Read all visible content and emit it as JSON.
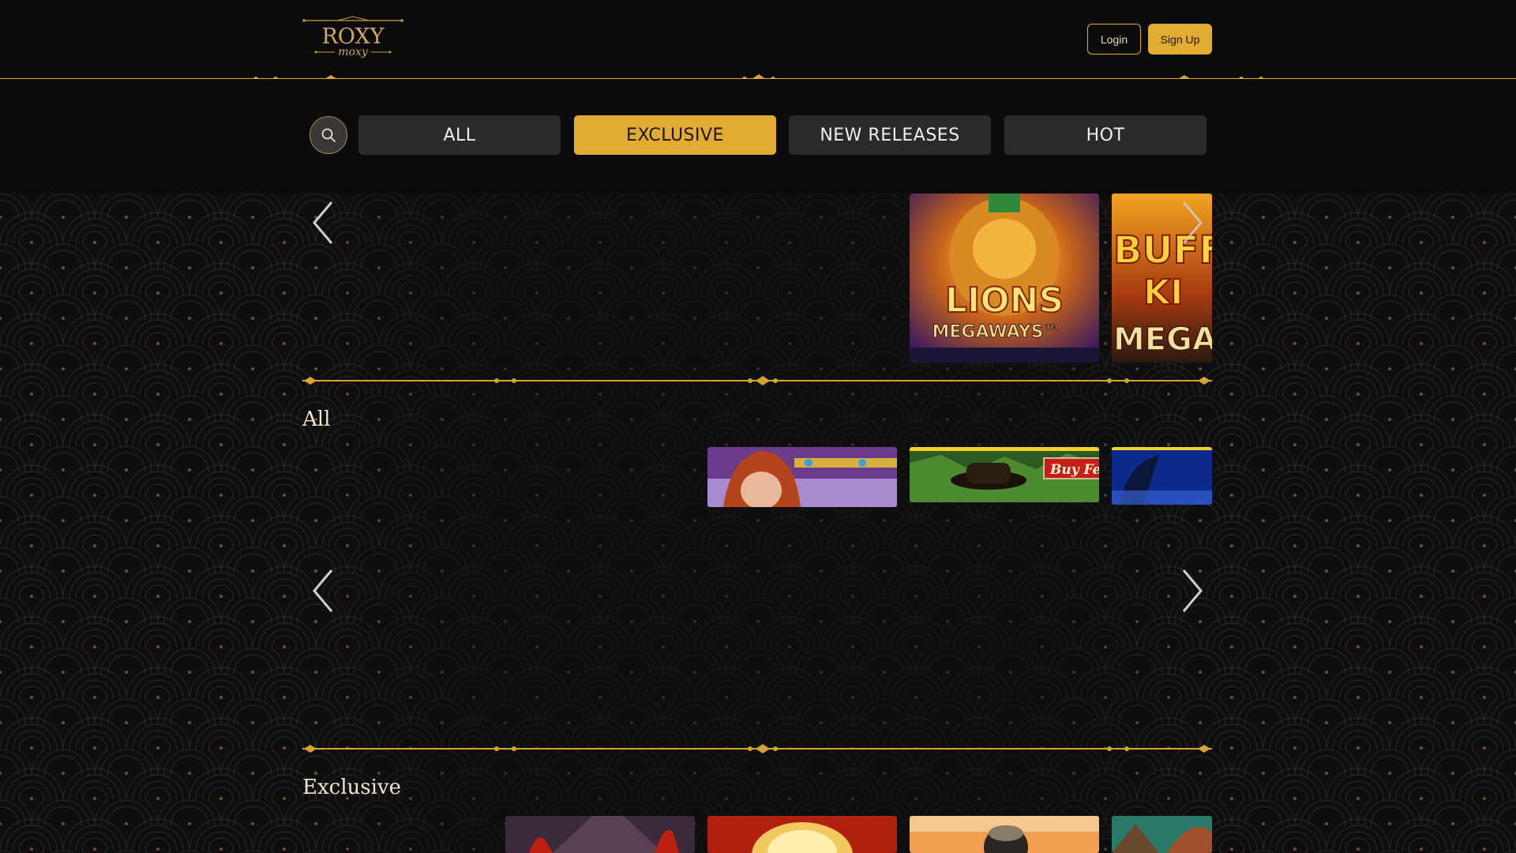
{
  "header": {
    "logo_line1": "ROXY",
    "logo_line2": "moxy",
    "login_label": "Login",
    "signup_label": "Sign Up"
  },
  "filters": {
    "tabs": [
      {
        "label": "ALL",
        "active": false
      },
      {
        "label": "EXCLUSIVE",
        "active": true
      },
      {
        "label": "NEW RELEASES",
        "active": false
      },
      {
        "label": "HOT",
        "active": false
      }
    ]
  },
  "featured": {
    "cards": [
      {
        "title_main": "LIONS",
        "title_sub": "MEGAWAYS™"
      },
      {
        "title_main": "BUFF",
        "title_mid": "KI",
        "title_sub": "MEGA"
      }
    ]
  },
  "sections": [
    {
      "title": "All",
      "cards": [
        {
          "badge": ""
        },
        {
          "badge": "Buy Fea"
        },
        {
          "badge": ""
        }
      ]
    },
    {
      "title": "Exclusive"
    }
  ],
  "colors": {
    "accent": "#e2ac33",
    "background": "#0b0b0d",
    "tab_inactive": "#2a2a2d"
  }
}
